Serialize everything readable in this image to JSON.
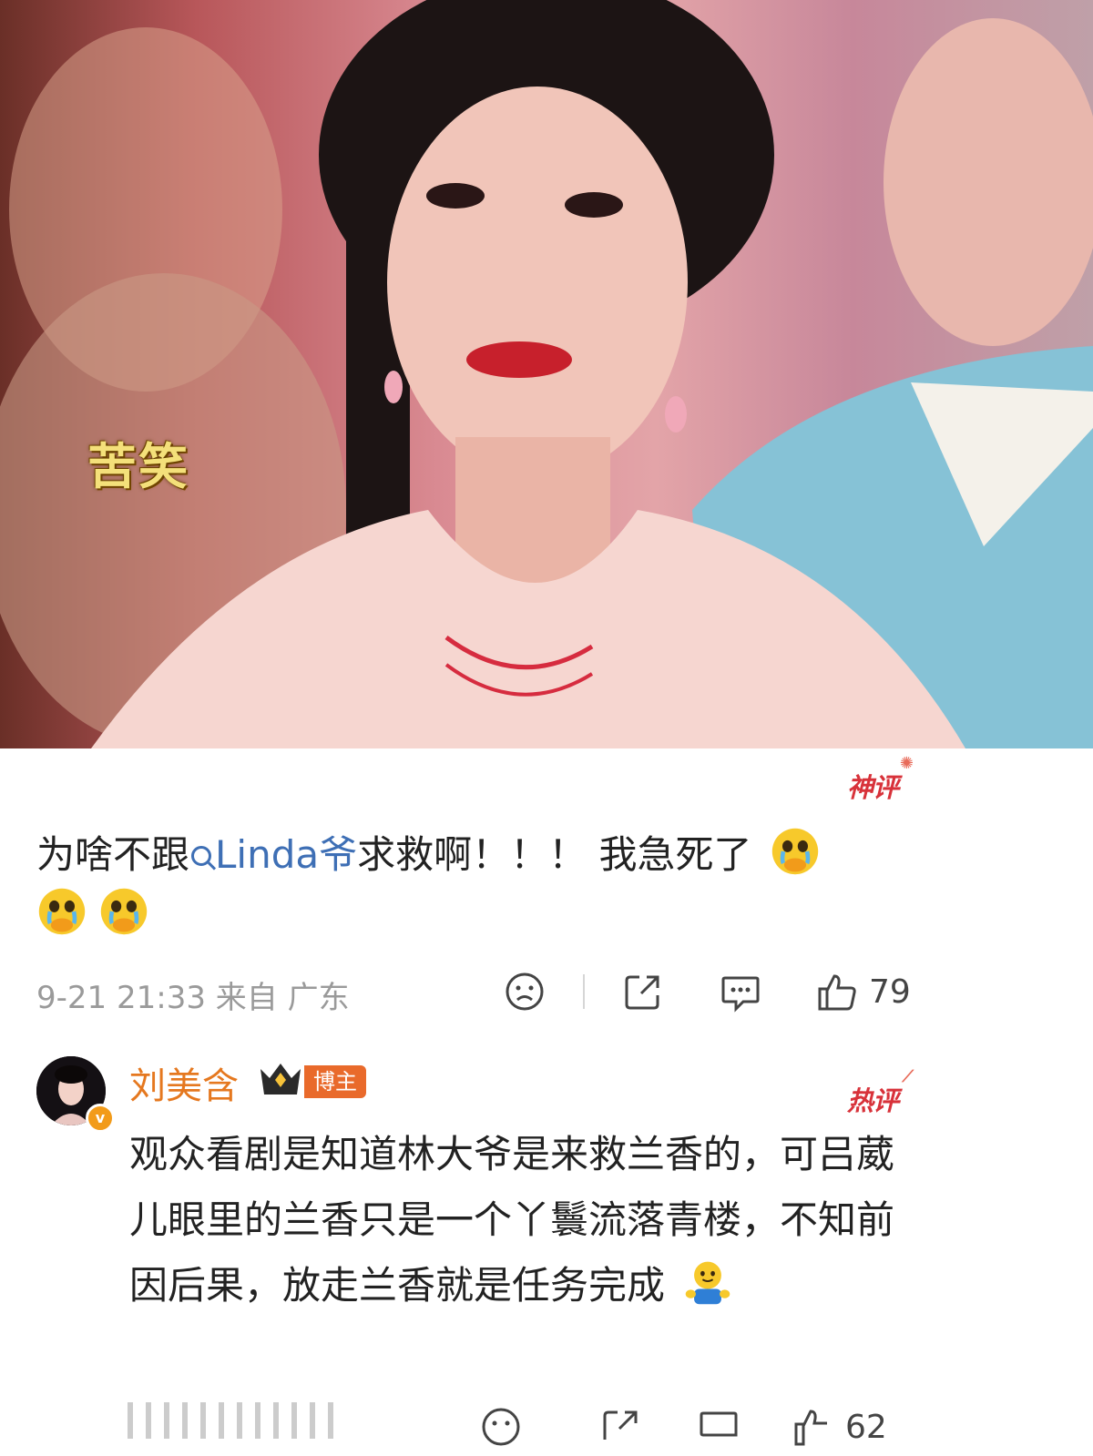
{
  "media": {
    "overlay_caption": "苦笑"
  },
  "comment1": {
    "badge": "神评",
    "text_before": "为啥不跟",
    "mention": "Linda爷",
    "text_after": "求救啊！！！ 我急死了",
    "emoji": "crying-face-emoji",
    "timestamp": "9-21 21:33 来自 广东",
    "likes": "79"
  },
  "comment2": {
    "author": "刘美含",
    "author_tag": "博主",
    "badge": "热评",
    "text": "观众看剧是知道林大爷是来救兰香的，可吕葳儿眼里的兰香只是一个丫鬟流落青楼，不知前因后果，放走兰香就是任务完成",
    "likes": "62"
  },
  "colors": {
    "accent_red": "#d8323a",
    "mention_blue": "#3e6fb5",
    "author_orange": "#e5781f"
  }
}
